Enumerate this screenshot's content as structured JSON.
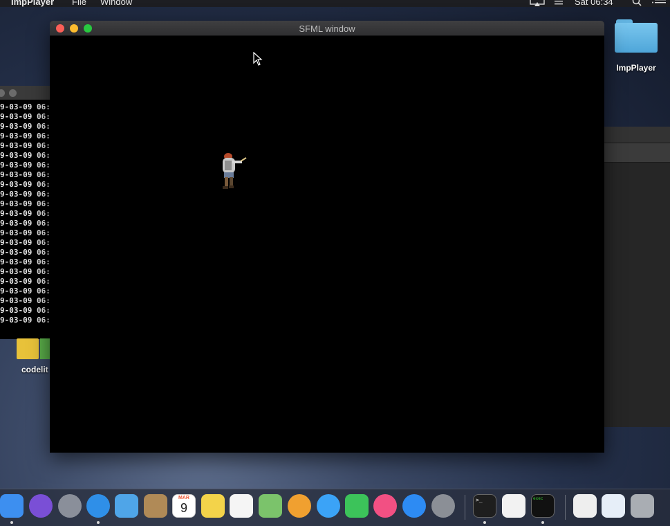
{
  "menubar": {
    "app_name": "ImpPlayer",
    "menus": [
      "File",
      "Window"
    ],
    "clock": "Sat 06:34"
  },
  "desktop": {
    "folder_label": "ImpPlayer",
    "codelite_label": "codelit"
  },
  "terminal": {
    "lines": [
      "9-03-09 06:",
      "9-03-09 06:",
      "9-03-09 06:",
      "9-03-09 06:",
      "9-03-09 06:",
      "9-03-09 06:",
      "9-03-09 06:",
      "9-03-09 06:",
      "9-03-09 06:",
      "9-03-09 06:",
      "9-03-09 06:",
      "9-03-09 06:",
      "9-03-09 06:",
      "9-03-09 06:",
      "9-03-09 06:",
      "9-03-09 06:",
      "9-03-09 06:",
      "9-03-09 06:",
      "9-03-09 06:",
      "9-03-09 06:",
      "9-03-09 06:",
      "9-03-09 06:",
      "9-03-09 06:"
    ]
  },
  "sfml_window": {
    "title": "SFML window"
  },
  "dock": {
    "calendar_month": "MAR",
    "calendar_day": "9",
    "terminal_prompt": ">_",
    "exec_label": "exec",
    "items": [
      {
        "name": "finder-icon",
        "color": "#3d8ff0",
        "running": true
      },
      {
        "name": "siri-icon",
        "color": "#7a4fd6",
        "running": false
      },
      {
        "name": "launchpad-icon",
        "color": "#8a8f9a",
        "running": false
      },
      {
        "name": "safari-icon",
        "color": "#2f8fe8",
        "running": true
      },
      {
        "name": "mail-icon",
        "color": "#4fa5e8",
        "running": false
      },
      {
        "name": "contacts-icon",
        "color": "#b08a57",
        "running": false
      },
      {
        "name": "calendar-icon",
        "color": "#ffffff",
        "running": false
      },
      {
        "name": "notes-icon",
        "color": "#f3d34a",
        "running": false
      },
      {
        "name": "reminders-icon",
        "color": "#f5f5f5",
        "running": false
      },
      {
        "name": "maps-icon",
        "color": "#7bc36b",
        "running": false
      },
      {
        "name": "photos-icon",
        "color": "#f0a030",
        "running": false
      },
      {
        "name": "messages-icon",
        "color": "#3ba3f7",
        "running": false
      },
      {
        "name": "facetime-icon",
        "color": "#3cc35a",
        "running": false
      },
      {
        "name": "itunes-icon",
        "color": "#f25083",
        "running": false
      },
      {
        "name": "app-store-icon",
        "color": "#2d8bf3",
        "running": false
      },
      {
        "name": "system-preferences-icon",
        "color": "#8b8f96",
        "running": false
      },
      {
        "name": "terminal-icon",
        "color": "#1e1e1e",
        "running": true
      },
      {
        "name": "textedit-icon",
        "color": "#f2f2f2",
        "running": false
      },
      {
        "name": "exec-icon",
        "color": "#111111",
        "running": true
      },
      {
        "name": "archive-icon",
        "color": "#eeeeee",
        "running": false
      },
      {
        "name": "preview-icon",
        "color": "#e6eef8",
        "running": false
      },
      {
        "name": "trash-icon",
        "color": "#a9adb3",
        "running": false
      }
    ]
  }
}
